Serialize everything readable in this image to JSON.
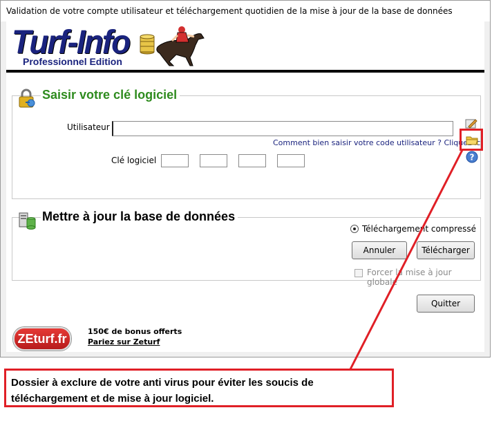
{
  "window": {
    "title": "Validation de votre compte utilisateur et téléchargement quotidien de la mise à jour de la base de données"
  },
  "logo": {
    "name": "Turf-Info",
    "edition": "Professionnel Edition"
  },
  "key_section": {
    "title": "Saisir votre clé logiciel",
    "user_label": "Utilisateur",
    "user_value": "",
    "help_link": "Comment bien saisir votre code utilisateur ? Cliquez ici",
    "key_label": "Clé logiciel",
    "key_parts": [
      "",
      "",
      "",
      ""
    ]
  },
  "update_section": {
    "title": "Mettre à jour la base de données",
    "radio_label": "Téléchargement compressé",
    "cancel_label": "Annuler",
    "download_label": "Télécharger",
    "force_label": "Forcer la mise à jour globale"
  },
  "quit_label": "Quitter",
  "promo": {
    "brand": "ZEturf.fr",
    "line1": "150€ de bonus offerts",
    "line2": "Pariez sur Zeturf"
  },
  "annotation": {
    "text": "Dossier à exclure de votre anti virus pour éviter les soucis de téléchargement et de mise à jour logiciel."
  },
  "colors": {
    "accent_green": "#2e8b1e",
    "annotation_red": "#e01f26",
    "logo_blue": "#1a237e"
  }
}
